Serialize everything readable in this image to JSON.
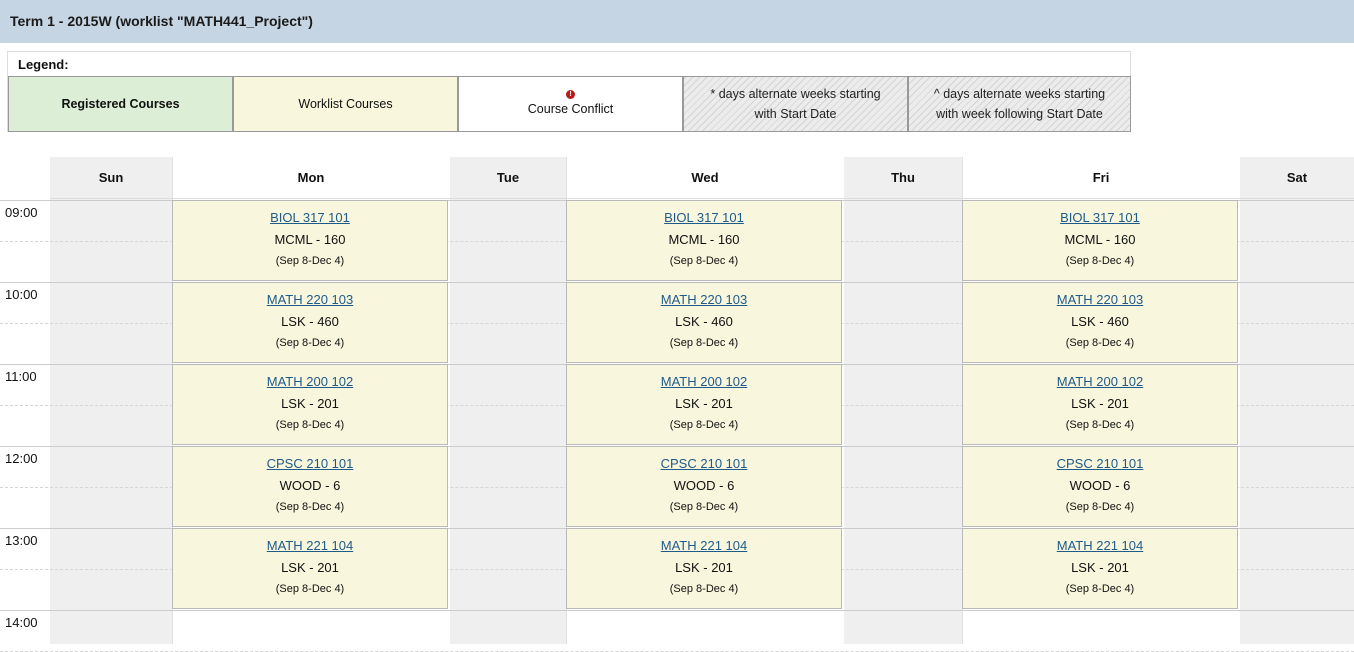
{
  "header": {
    "title": "Term 1 - 2015W (worklist \"MATH441_Project\")"
  },
  "legend": {
    "label": "Legend:",
    "registered": "Registered Courses",
    "worklist": "Worklist Courses",
    "conflict_icon": "!",
    "conflict": "Course Conflict",
    "alt1_line1": "* days alternate weeks starting",
    "alt1_line2": "with Start Date",
    "alt2_line1": "^ days alternate weeks starting",
    "alt2_line2": "with week following Start Date"
  },
  "days": [
    "Sun",
    "Mon",
    "Tue",
    "Wed",
    "Thu",
    "Fri",
    "Sat"
  ],
  "times": [
    "09:00",
    "10:00",
    "11:00",
    "12:00",
    "13:00",
    "14:00"
  ],
  "courses": [
    {
      "code": "BIOL 317 101",
      "room": "MCML - 160",
      "dates": "(Sep 8-Dec 4)"
    },
    {
      "code": "MATH 220 103",
      "room": "LSK - 460",
      "dates": "(Sep 8-Dec 4)"
    },
    {
      "code": "MATH 200 102",
      "room": "LSK - 201",
      "dates": "(Sep 8-Dec 4)"
    },
    {
      "code": "CPSC 210 101",
      "room": "WOOD - 6",
      "dates": "(Sep 8-Dec 4)"
    },
    {
      "code": "MATH 221 104",
      "room": "LSK - 201",
      "dates": "(Sep 8-Dec 4)"
    }
  ],
  "colors": {
    "worklist": "#f8f6dc",
    "registered": "#dcefd6",
    "header": "#c6d5e3",
    "link": "#1f5b8a"
  }
}
